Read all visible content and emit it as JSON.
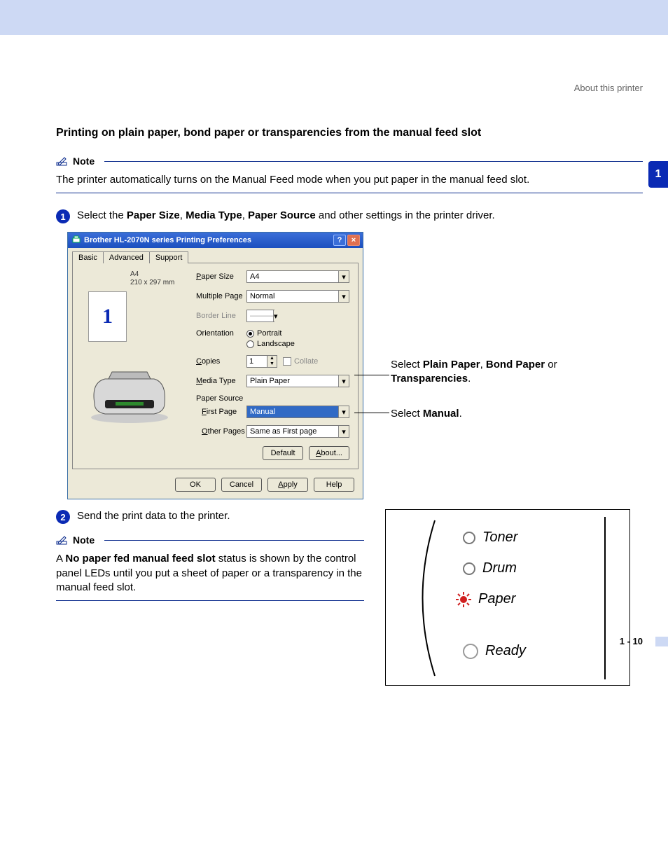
{
  "header": {
    "crumb": "About this printer"
  },
  "chapter_tab": "1",
  "title": "Printing on plain paper, bond paper or transparencies from the manual feed slot",
  "note1": {
    "label": "Note",
    "text": "The printer automatically turns on the Manual Feed mode when you put paper in the manual feed slot."
  },
  "step1": {
    "num": "1",
    "pre": "Select the",
    "b1": "Paper Size",
    "c1": ",",
    "b2": "Media Type",
    "c2": ",",
    "b3": "Paper Source",
    "post": "and other settings in the printer driver."
  },
  "dialog": {
    "title": "Brother HL-2070N series Printing Preferences",
    "tabs": {
      "basic": "Basic",
      "advanced": "Advanced",
      "support": "Support"
    },
    "paper_meta_name": "A4",
    "paper_meta_dim": "210 x 297 mm",
    "preview_num": "1",
    "labels": {
      "paper_size": "Paper Size",
      "multiple_page": "Multiple Page",
      "border_line": "Border Line",
      "orientation": "Orientation",
      "copies": "Copies",
      "media_type": "Media Type",
      "paper_source": "Paper Source",
      "first_page": "First Page",
      "other_pages": "Other Pages"
    },
    "values": {
      "paper_size": "A4",
      "multiple_page": "Normal",
      "border_line": "———",
      "portrait": "Portrait",
      "landscape": "Landscape",
      "copies": "1",
      "collate": "Collate",
      "media_type": "Plain Paper",
      "first_page": "Manual",
      "other_pages": "Same as First page"
    },
    "buttons": {
      "default": "Default",
      "about": "About...",
      "ok": "OK",
      "cancel": "Cancel",
      "apply": "Apply",
      "help": "Help"
    }
  },
  "callouts": {
    "media_pre": "Select",
    "media_b1": "Plain Paper",
    "media_mid1": ",",
    "media_b2": "Bond Paper",
    "media_mid2": "or",
    "media_b3": "Transparencies",
    "media_end": ".",
    "source_pre": "Select",
    "source_b": "Manual",
    "source_end": "."
  },
  "step2": {
    "num": "2",
    "text": "Send the print data to the printer."
  },
  "note2": {
    "label": "Note",
    "pre": "A",
    "b": "No paper fed manual feed slot",
    "post": "status is shown by the control panel LEDs until you put a sheet of paper or a transparency in the manual feed slot."
  },
  "leds": {
    "toner": "Toner",
    "drum": "Drum",
    "paper": "Paper",
    "ready": "Ready"
  },
  "footer": "1 - 10"
}
